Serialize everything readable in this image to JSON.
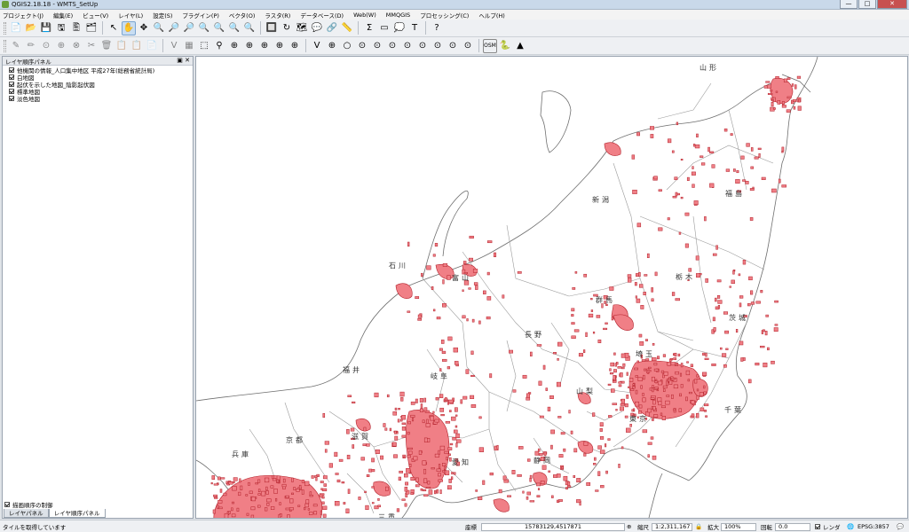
{
  "window": {
    "title": "QGIS2.18.18 - WMTS_SetUp",
    "minimize": "—",
    "maximize": "□",
    "close": "✕"
  },
  "menu": [
    "プロジェクト(J)",
    "編集(E)",
    "ビュー(V)",
    "レイヤ(L)",
    "設定(S)",
    "プラグイン(P)",
    "ベクタ(O)",
    "ラスタ(R)",
    "データベース(D)",
    "Web(W)",
    "MMQGIS",
    "プロセッシング(C)",
    "ヘルプ(H)"
  ],
  "toolbar1": [
    "📄",
    "📂",
    "💾",
    "🖫",
    "🖺",
    "🗂",
    "↖",
    "✋",
    "✥",
    "🔍",
    "🔎",
    "🔎",
    "🔍",
    "🔍",
    "🔍",
    "🔍",
    "🔲",
    "↻",
    "🗺",
    "💬",
    "🔗",
    "📏",
    "Σ",
    "▭",
    "💭",
    "T",
    "?"
  ],
  "toolbar2": [
    "✎",
    "✏",
    "⊙",
    "⊕",
    "⊗",
    "✂",
    "🗑",
    "📋",
    "📋",
    "📄",
    "V",
    "▦",
    "⬚",
    "⚲",
    "⊕",
    "⊕",
    "⊕",
    "⊕",
    "⊕",
    "V",
    "⊕",
    "○",
    "⊙",
    "⊙",
    "⊙",
    "⊙",
    "⊙",
    "⊙",
    "⊙",
    "⊙",
    "OSM",
    "🐍",
    "▲"
  ],
  "colors": {
    "urban_fill": "#f07f86",
    "urban_stroke": "#b3202a",
    "boundary": "#6f6f6f",
    "accent": "#7aa4d0"
  },
  "layer_panel": {
    "title": "レイヤ順序パネル",
    "layers": [
      {
        "label": "他機関の情報_人口集中地区 平成27年(総務省統計局)",
        "checked": true
      },
      {
        "label": "白地図",
        "checked": true
      },
      {
        "label": "起伏を示した地図_陰影起伏図",
        "checked": true
      },
      {
        "label": "標準地図",
        "checked": true
      },
      {
        "label": "淡色地図",
        "checked": true
      }
    ],
    "render_order_label": "描画順序の制御",
    "render_order_checked": true,
    "tabs": [
      "レイヤパネル",
      "レイヤ順序パネル"
    ]
  },
  "map": {
    "labels": [
      "山形",
      "新潟",
      "福島",
      "石川",
      "富山",
      "群馬",
      "栃木",
      "長野",
      "茨城",
      "福井",
      "岐阜",
      "埼玉",
      "山梨",
      "東京",
      "京都",
      "滋賀",
      "愛知",
      "兵庫",
      "静岡",
      "千葉",
      "三重"
    ]
  },
  "status": {
    "message": "タイルを取得しています",
    "coord_label": "座標",
    "coord_value": "15783129,4517871",
    "scale_label": "縮尺",
    "scale_value": "1:2,311,167",
    "zoom_label": "拡大",
    "zoom_value": "100%",
    "rotation_label": "回転",
    "rotation_value": "0.0",
    "render_label": "レンダ",
    "render_checked": true,
    "crs": "EPSG:3857"
  }
}
